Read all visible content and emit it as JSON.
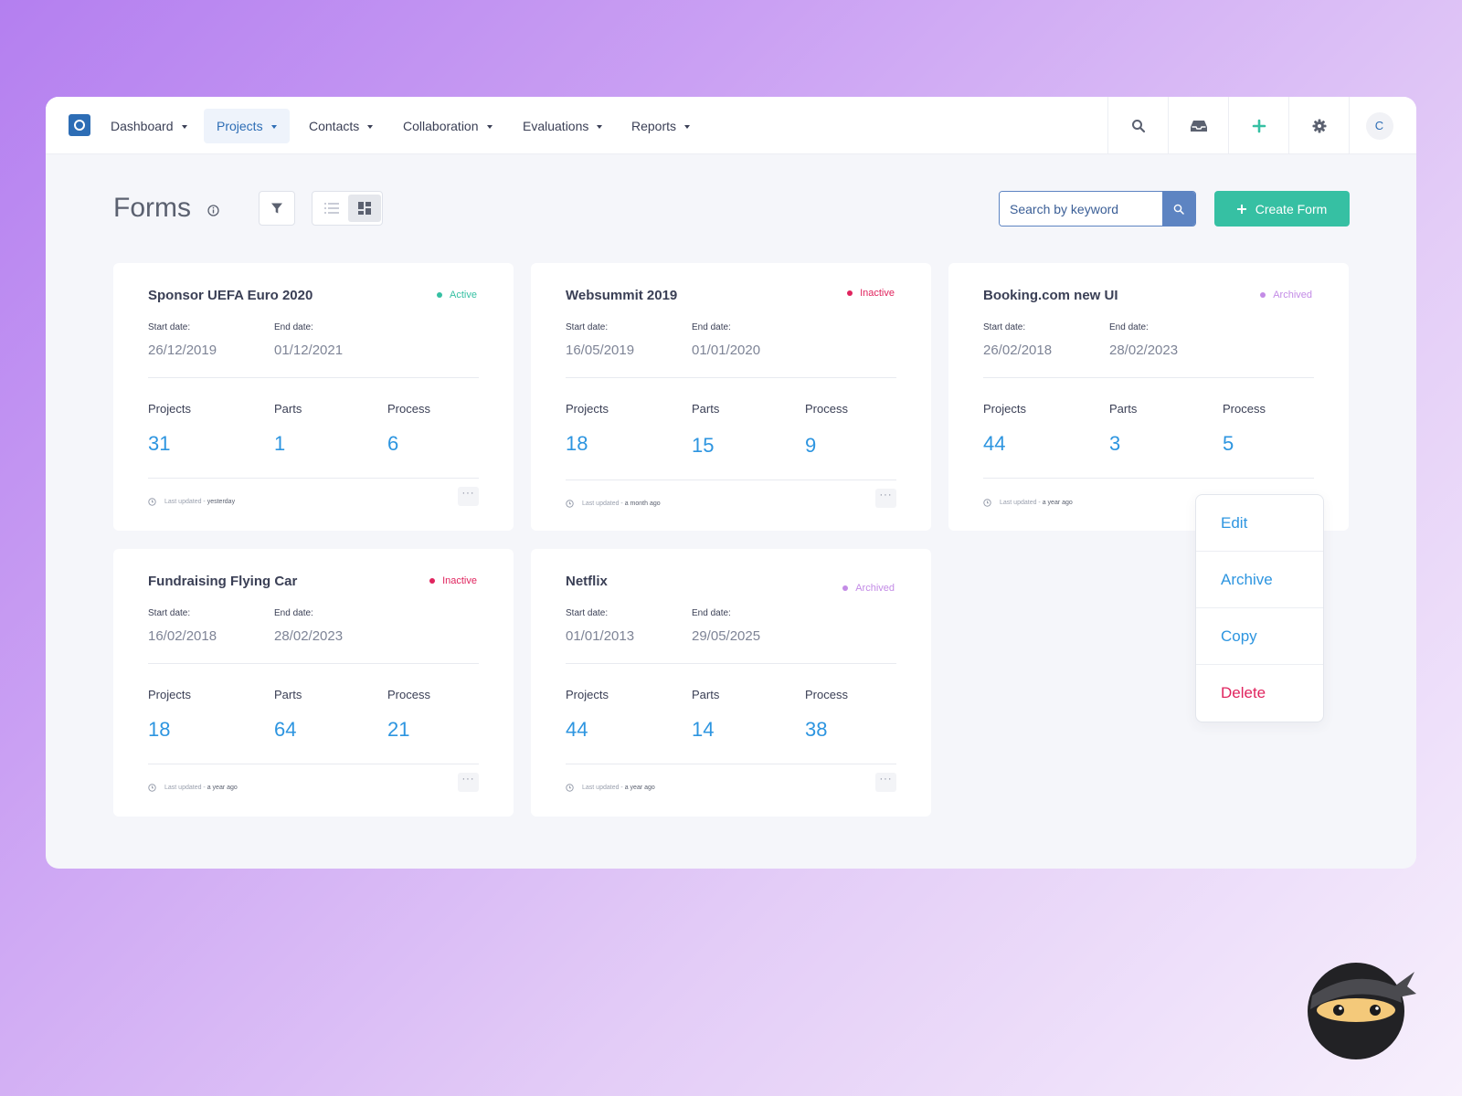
{
  "nav": {
    "items": [
      {
        "label": "Dashboard"
      },
      {
        "label": "Projects"
      },
      {
        "label": "Contacts"
      },
      {
        "label": "Collaboration"
      },
      {
        "label": "Evaluations"
      },
      {
        "label": "Reports"
      }
    ],
    "active": "Projects",
    "avatar_initial": "C"
  },
  "page": {
    "title": "Forms",
    "search_placeholder": "Search by keyword",
    "create_label": "Create Form"
  },
  "labels": {
    "start": "Start date:",
    "end": "End date:",
    "projects": "Projects",
    "parts": "Parts",
    "process": "Process",
    "last_updated": "Last updated -"
  },
  "colors": {
    "accent": "#2d6db5",
    "active": "#36c0a3",
    "inactive": "#e0245e",
    "archived": "#c38be6",
    "metric": "#2d95e0"
  },
  "cards": [
    {
      "title": "Sponsor UEFA Euro 2020",
      "status": "Active",
      "start": "26/12/2019",
      "end": "01/12/2021",
      "projects": "31",
      "parts": "1",
      "process": "6",
      "updated": "yesterday"
    },
    {
      "title": "Websummit 2019",
      "status": "Inactive",
      "start": "16/05/2019",
      "end": "01/01/2020",
      "projects": "18",
      "parts": "15",
      "process": "9",
      "updated": "a month ago"
    },
    {
      "title": "Booking.com new UI",
      "status": "Archived",
      "start": "26/02/2018",
      "end": "28/02/2023",
      "projects": "44",
      "parts": "3",
      "process": "5",
      "updated": "a year ago"
    },
    {
      "title": "Fundraising Flying Car",
      "status": "Inactive",
      "start": "16/02/2018",
      "end": "28/02/2023",
      "projects": "18",
      "parts": "64",
      "process": "21",
      "updated": "a year ago"
    },
    {
      "title": "Netflix",
      "status": "Archived",
      "start": "01/01/2013",
      "end": "29/05/2025",
      "projects": "44",
      "parts": "14",
      "process": "38",
      "updated": "a year ago"
    }
  ],
  "context_menu": {
    "items": [
      "Edit",
      "Archive",
      "Copy",
      "Delete"
    ]
  },
  "icons": {
    "search": "search-icon",
    "inbox": "inbox-icon",
    "add": "plus-icon",
    "settings": "gear-icon",
    "filter": "filter-icon",
    "list_view": "list-icon",
    "grid_view": "grid-icon",
    "info": "info-icon",
    "clock": "clock-icon",
    "more": "more-icon"
  }
}
